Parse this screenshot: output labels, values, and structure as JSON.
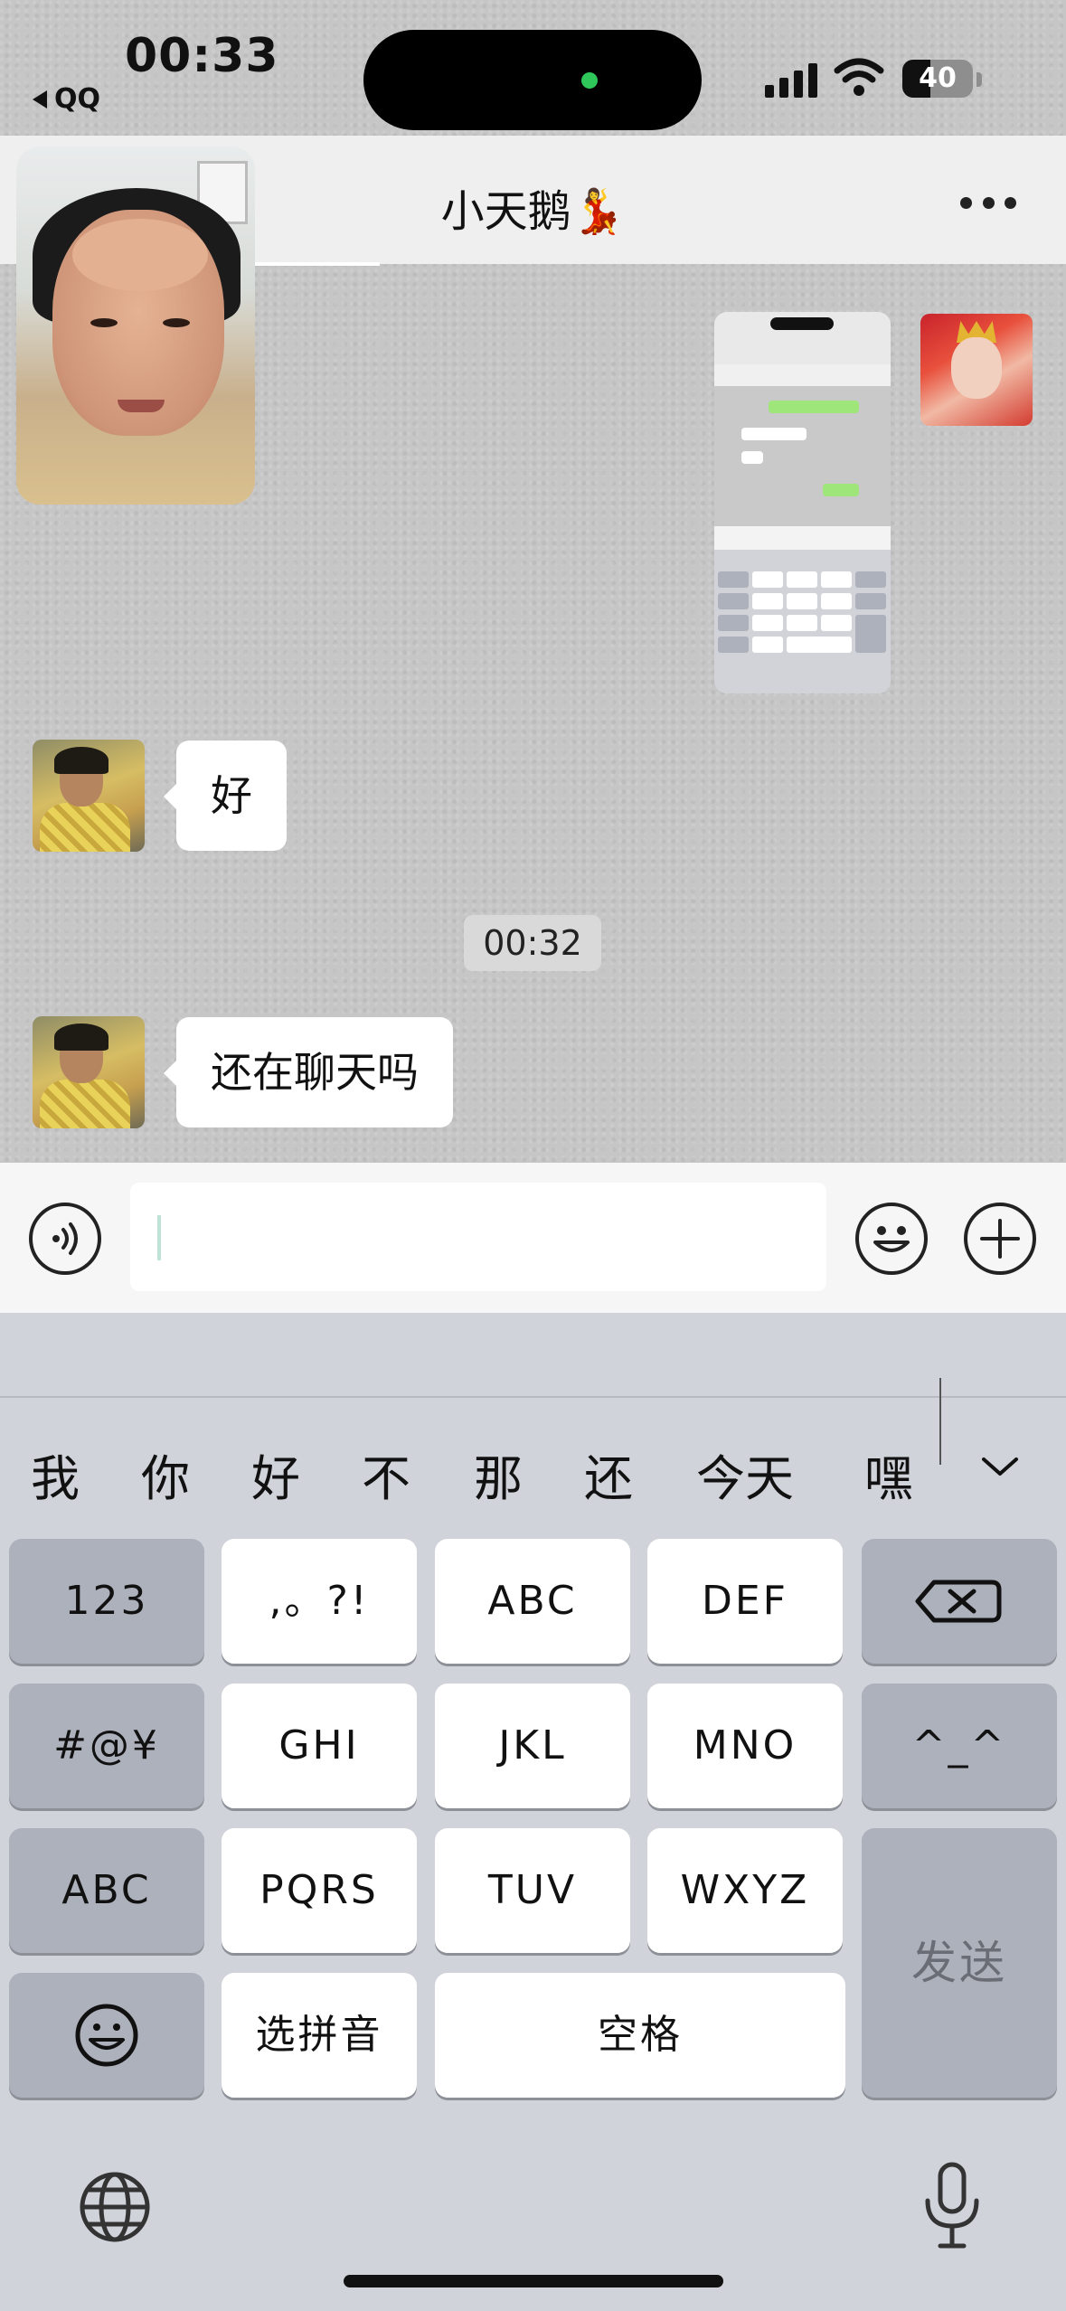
{
  "status_bar": {
    "time": "00:33",
    "back_app": "QQ",
    "battery_level": "40"
  },
  "nav": {
    "title": "小天鹅💃"
  },
  "messages": [
    {
      "sender": "contact",
      "text": "好"
    },
    {
      "timestamp": "00:32"
    },
    {
      "sender": "contact",
      "text": "还在聊天吗"
    }
  ],
  "input": {
    "value": ""
  },
  "keyboard": {
    "candidates": [
      "我",
      "你",
      "好",
      "不",
      "那",
      "还",
      "今天",
      "嘿嘿"
    ],
    "keys": {
      "num": "123",
      "punct": ",。?!",
      "abc1": "ABC",
      "def": "DEF",
      "symbols": "#@¥",
      "ghi": "GHI",
      "jkl": "JKL",
      "mno": "MNO",
      "emoticon": "^_^",
      "abc_switch": "ABC",
      "pqrs": "PQRS",
      "tuv": "TUV",
      "wxyz": "WXYZ",
      "send": "发送",
      "pinyin": "选拼音",
      "space": "空格"
    }
  },
  "icons": {
    "back": "back-arrow-icon",
    "more": "more-icon",
    "voice": "voice-icon",
    "emoji": "emoji-icon",
    "plus": "plus-icon",
    "delete": "delete-icon",
    "globe": "globe-icon",
    "mic": "microphone-icon",
    "collapse": "chevron-down-icon"
  },
  "colors": {
    "chat_bg": "#c6c6c6",
    "bubble": "#ffffff",
    "keyboard_bg": "#d0d3da",
    "key": "#ffffff",
    "key_dark": "#adb1bb",
    "island_dot": "#2fc75a"
  }
}
